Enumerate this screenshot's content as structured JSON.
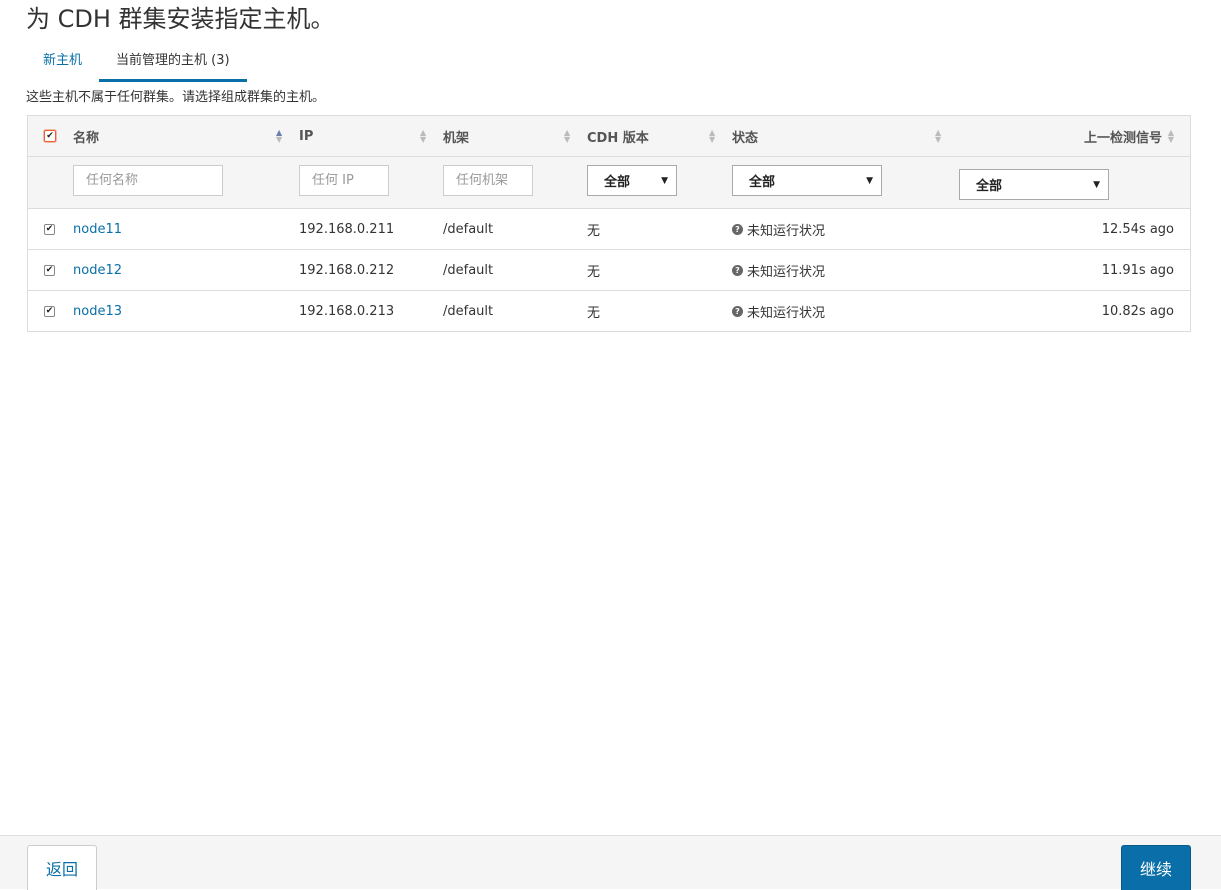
{
  "page": {
    "title": "为 CDH 群集安装指定主机。",
    "subtitle": "这些主机不属于任何群集。请选择组成群集的主机。"
  },
  "tabs": [
    {
      "label": "新主机",
      "active": false
    },
    {
      "label": "当前管理的主机 (3)",
      "active": true
    }
  ],
  "table": {
    "columns": {
      "name": "名称",
      "ip": "IP",
      "rack": "机架",
      "cdh_version": "CDH 版本",
      "status": "状态",
      "last_heartbeat": "上一检测信号"
    },
    "sorted_column": "name",
    "filters": {
      "name_placeholder": "任何名称",
      "ip_placeholder": "任何 IP",
      "rack_placeholder": "任何机架",
      "cdh_version_selected": "全部",
      "status_selected": "全部",
      "last_heartbeat_selected": "全部"
    },
    "rows": [
      {
        "checked": true,
        "name": "node11",
        "ip": "192.168.0.211",
        "rack": "/default",
        "cdh_version": "无",
        "status": "未知运行状况",
        "last_heartbeat": "12.54s ago"
      },
      {
        "checked": true,
        "name": "node12",
        "ip": "192.168.0.212",
        "rack": "/default",
        "cdh_version": "无",
        "status": "未知运行状况",
        "last_heartbeat": "11.91s ago"
      },
      {
        "checked": true,
        "name": "node13",
        "ip": "192.168.0.213",
        "rack": "/default",
        "cdh_version": "无",
        "status": "未知运行状况",
        "last_heartbeat": "10.82s ago"
      }
    ]
  },
  "footer": {
    "back_label": "返回",
    "continue_label": "继续"
  },
  "icons": {
    "status_icon": "question-circle-icon",
    "sort_icon": "sort-arrows-icon",
    "check_icon": "checkmark-icon"
  },
  "colors": {
    "accent": "#0a6fa8",
    "header_bg": "#f5f5f5"
  }
}
